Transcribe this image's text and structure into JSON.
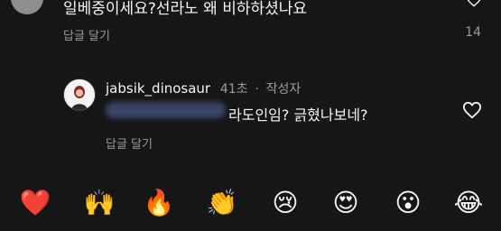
{
  "top_comment": {
    "text": "일베중이세요?선라노 왜 비하하셨나요",
    "reply_label": "답글 달기",
    "like_count": "14"
  },
  "reply": {
    "username": "jabsik_dinosaur",
    "time": "41초",
    "separator": "·",
    "author_badge": "작성자",
    "text": "라도인임? 긁혔나보네?",
    "reply_label": "답글 달기"
  },
  "emoji_bar": [
    {
      "icon": "red-heart",
      "glyph": "❤️"
    },
    {
      "icon": "raising-hands",
      "glyph": "🙌"
    },
    {
      "icon": "fire",
      "glyph": "🔥"
    },
    {
      "icon": "clapping-hands",
      "glyph": "👏"
    },
    {
      "icon": "crying-face",
      "glyph": "😢"
    },
    {
      "icon": "heart-eyes",
      "glyph": "😍"
    },
    {
      "icon": "surprised-face",
      "glyph": "😮"
    },
    {
      "icon": "laughing-face",
      "glyph": "😂"
    }
  ],
  "colors": {
    "background": "#161616",
    "muted_text": "#9a9a9a",
    "text": "#f5f5f5"
  }
}
